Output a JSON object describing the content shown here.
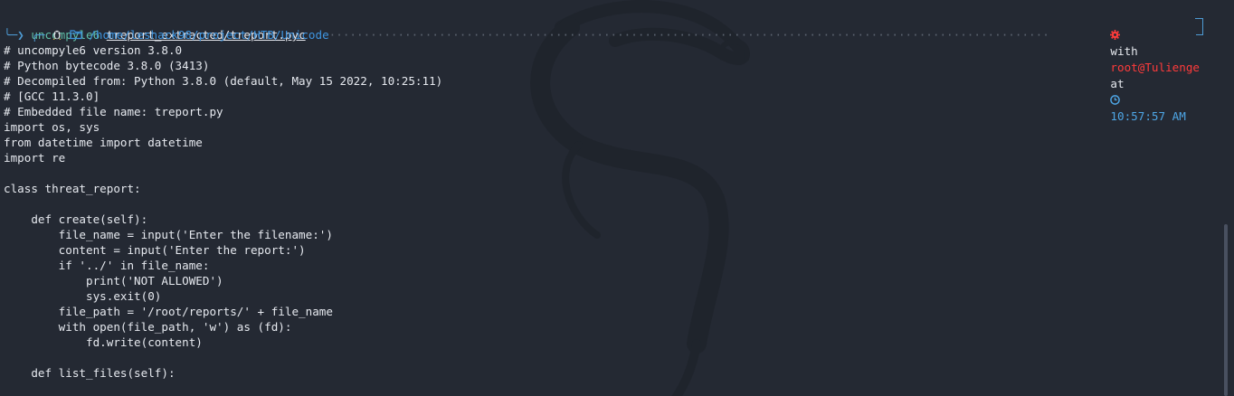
{
  "prompt": {
    "path": "/home/leshack98/project/HTB/Unicode",
    "with_label": "with",
    "user_host": "root@Tulienge",
    "at_label": "at",
    "time": "10:57:57 AM",
    "command": "uncompyle6",
    "argument": "treport_extracted/treport.pyc"
  },
  "output_lines": [
    "# uncompyle6 version 3.8.0",
    "# Python bytecode 3.8.0 (3413)",
    "# Decompiled from: Python 3.8.0 (default, May 15 2022, 10:25:11)",
    "# [GCC 11.3.0]",
    "# Embedded file name: treport.py",
    "import os, sys",
    "from datetime import datetime",
    "import re",
    "",
    "class threat_report:",
    "",
    "    def create(self):",
    "        file_name = input('Enter the filename:')",
    "        content = input('Enter the report:')",
    "        if '../' in file_name:",
    "            print('NOT ALLOWED')",
    "            sys.exit(0)",
    "        file_path = '/root/reports/' + file_name",
    "        with open(file_path, 'w') as (fd):",
    "            fd.write(content)",
    "",
    "    def list_files(self):"
  ],
  "colors": {
    "background": "#242933",
    "path": "#3e95e0",
    "user_host": "#ff3b3b",
    "command": "#5fbfa8",
    "time": "#4ea6e6"
  },
  "icons": {
    "os": "tux-icon",
    "folder": "folder-icon",
    "root": "gear-icon",
    "clock": "clock-icon"
  }
}
